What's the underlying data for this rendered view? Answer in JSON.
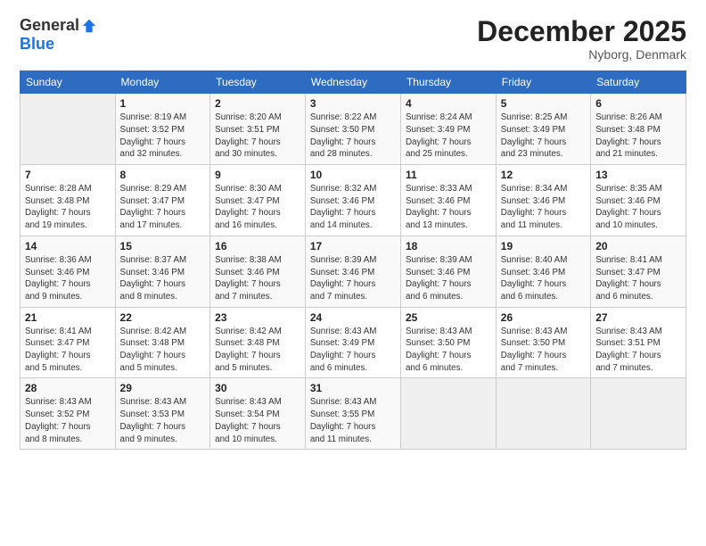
{
  "logo": {
    "general": "General",
    "blue": "Blue"
  },
  "title": "December 2025",
  "location": "Nyborg, Denmark",
  "days_of_week": [
    "Sunday",
    "Monday",
    "Tuesday",
    "Wednesday",
    "Thursday",
    "Friday",
    "Saturday"
  ],
  "weeks": [
    [
      {
        "day": "",
        "info": ""
      },
      {
        "day": "1",
        "info": "Sunrise: 8:19 AM\nSunset: 3:52 PM\nDaylight: 7 hours\nand 32 minutes."
      },
      {
        "day": "2",
        "info": "Sunrise: 8:20 AM\nSunset: 3:51 PM\nDaylight: 7 hours\nand 30 minutes."
      },
      {
        "day": "3",
        "info": "Sunrise: 8:22 AM\nSunset: 3:50 PM\nDaylight: 7 hours\nand 28 minutes."
      },
      {
        "day": "4",
        "info": "Sunrise: 8:24 AM\nSunset: 3:49 PM\nDaylight: 7 hours\nand 25 minutes."
      },
      {
        "day": "5",
        "info": "Sunrise: 8:25 AM\nSunset: 3:49 PM\nDaylight: 7 hours\nand 23 minutes."
      },
      {
        "day": "6",
        "info": "Sunrise: 8:26 AM\nSunset: 3:48 PM\nDaylight: 7 hours\nand 21 minutes."
      }
    ],
    [
      {
        "day": "7",
        "info": "Sunrise: 8:28 AM\nSunset: 3:48 PM\nDaylight: 7 hours\nand 19 minutes."
      },
      {
        "day": "8",
        "info": "Sunrise: 8:29 AM\nSunset: 3:47 PM\nDaylight: 7 hours\nand 17 minutes."
      },
      {
        "day": "9",
        "info": "Sunrise: 8:30 AM\nSunset: 3:47 PM\nDaylight: 7 hours\nand 16 minutes."
      },
      {
        "day": "10",
        "info": "Sunrise: 8:32 AM\nSunset: 3:46 PM\nDaylight: 7 hours\nand 14 minutes."
      },
      {
        "day": "11",
        "info": "Sunrise: 8:33 AM\nSunset: 3:46 PM\nDaylight: 7 hours\nand 13 minutes."
      },
      {
        "day": "12",
        "info": "Sunrise: 8:34 AM\nSunset: 3:46 PM\nDaylight: 7 hours\nand 11 minutes."
      },
      {
        "day": "13",
        "info": "Sunrise: 8:35 AM\nSunset: 3:46 PM\nDaylight: 7 hours\nand 10 minutes."
      }
    ],
    [
      {
        "day": "14",
        "info": "Sunrise: 8:36 AM\nSunset: 3:46 PM\nDaylight: 7 hours\nand 9 minutes."
      },
      {
        "day": "15",
        "info": "Sunrise: 8:37 AM\nSunset: 3:46 PM\nDaylight: 7 hours\nand 8 minutes."
      },
      {
        "day": "16",
        "info": "Sunrise: 8:38 AM\nSunset: 3:46 PM\nDaylight: 7 hours\nand 7 minutes."
      },
      {
        "day": "17",
        "info": "Sunrise: 8:39 AM\nSunset: 3:46 PM\nDaylight: 7 hours\nand 7 minutes."
      },
      {
        "day": "18",
        "info": "Sunrise: 8:39 AM\nSunset: 3:46 PM\nDaylight: 7 hours\nand 6 minutes."
      },
      {
        "day": "19",
        "info": "Sunrise: 8:40 AM\nSunset: 3:46 PM\nDaylight: 7 hours\nand 6 minutes."
      },
      {
        "day": "20",
        "info": "Sunrise: 8:41 AM\nSunset: 3:47 PM\nDaylight: 7 hours\nand 6 minutes."
      }
    ],
    [
      {
        "day": "21",
        "info": "Sunrise: 8:41 AM\nSunset: 3:47 PM\nDaylight: 7 hours\nand 5 minutes."
      },
      {
        "day": "22",
        "info": "Sunrise: 8:42 AM\nSunset: 3:48 PM\nDaylight: 7 hours\nand 5 minutes."
      },
      {
        "day": "23",
        "info": "Sunrise: 8:42 AM\nSunset: 3:48 PM\nDaylight: 7 hours\nand 5 minutes."
      },
      {
        "day": "24",
        "info": "Sunrise: 8:43 AM\nSunset: 3:49 PM\nDaylight: 7 hours\nand 6 minutes."
      },
      {
        "day": "25",
        "info": "Sunrise: 8:43 AM\nSunset: 3:50 PM\nDaylight: 7 hours\nand 6 minutes."
      },
      {
        "day": "26",
        "info": "Sunrise: 8:43 AM\nSunset: 3:50 PM\nDaylight: 7 hours\nand 7 minutes."
      },
      {
        "day": "27",
        "info": "Sunrise: 8:43 AM\nSunset: 3:51 PM\nDaylight: 7 hours\nand 7 minutes."
      }
    ],
    [
      {
        "day": "28",
        "info": "Sunrise: 8:43 AM\nSunset: 3:52 PM\nDaylight: 7 hours\nand 8 minutes."
      },
      {
        "day": "29",
        "info": "Sunrise: 8:43 AM\nSunset: 3:53 PM\nDaylight: 7 hours\nand 9 minutes."
      },
      {
        "day": "30",
        "info": "Sunrise: 8:43 AM\nSunset: 3:54 PM\nDaylight: 7 hours\nand 10 minutes."
      },
      {
        "day": "31",
        "info": "Sunrise: 8:43 AM\nSunset: 3:55 PM\nDaylight: 7 hours\nand 11 minutes."
      },
      {
        "day": "",
        "info": ""
      },
      {
        "day": "",
        "info": ""
      },
      {
        "day": "",
        "info": ""
      }
    ]
  ]
}
